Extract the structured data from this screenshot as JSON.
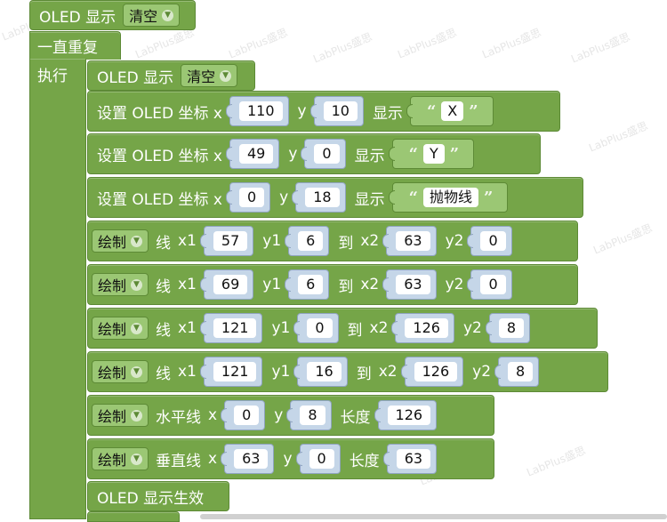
{
  "watermark": "LabPlus盛思",
  "header_block": {
    "label": "OLED 显示",
    "dropdown": "清空"
  },
  "loop": {
    "label": "一直重复",
    "do_label": "执行"
  },
  "clear_block": {
    "label": "OLED 显示",
    "dropdown": "清空"
  },
  "set_blocks": [
    {
      "label": "设置 OLED 坐标 x",
      "x": "110",
      "y_label": "y",
      "y": "10",
      "show_label": "显示",
      "text": "X"
    },
    {
      "label": "设置 OLED 坐标 x",
      "x": "49",
      "y_label": "y",
      "y": "0",
      "show_label": "显示",
      "text": "Y"
    },
    {
      "label": "设置 OLED 坐标 x",
      "x": "0",
      "y_label": "y",
      "y": "18",
      "show_label": "显示",
      "text": "抛物线"
    }
  ],
  "line_blocks": [
    {
      "dropdown": "绘制",
      "label": "线",
      "x1_label": "x1",
      "x1": "57",
      "y1_label": "y1",
      "y1": "6",
      "to_label": "到",
      "x2_label": "x2",
      "x2": "63",
      "y2_label": "y2",
      "y2": "0"
    },
    {
      "dropdown": "绘制",
      "label": "线",
      "x1_label": "x1",
      "x1": "69",
      "y1_label": "y1",
      "y1": "6",
      "to_label": "到",
      "x2_label": "x2",
      "x2": "63",
      "y2_label": "y2",
      "y2": "0"
    },
    {
      "dropdown": "绘制",
      "label": "线",
      "x1_label": "x1",
      "x1": "121",
      "y1_label": "y1",
      "y1": "0",
      "to_label": "到",
      "x2_label": "x2",
      "x2": "126",
      "y2_label": "y2",
      "y2": "8"
    },
    {
      "dropdown": "绘制",
      "label": "线",
      "x1_label": "x1",
      "x1": "121",
      "y1_label": "y1",
      "y1": "16",
      "to_label": "到",
      "x2_label": "x2",
      "x2": "126",
      "y2_label": "y2",
      "y2": "8"
    }
  ],
  "hline_block": {
    "dropdown": "绘制",
    "label": "水平线",
    "x_label": "x",
    "x": "0",
    "y_label": "y",
    "y": "8",
    "len_label": "长度",
    "len": "126"
  },
  "vline_block": {
    "dropdown": "绘制",
    "label": "垂直线",
    "x_label": "x",
    "x": "63",
    "y_label": "y",
    "y": "0",
    "len_label": "长度",
    "len": "63"
  },
  "apply_block": {
    "label": "OLED 显示生效"
  },
  "colors": {
    "block_green": "#75a548",
    "dropdown_green": "#9bc774",
    "number_slot": "#c5d6e8"
  }
}
